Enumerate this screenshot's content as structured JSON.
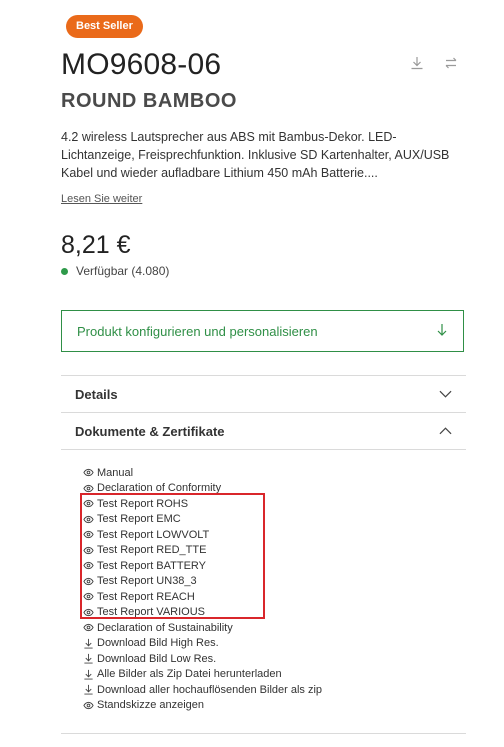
{
  "badge": "Best Seller",
  "product": {
    "code": "MO9608-06",
    "name": "ROUND BAMBOO",
    "description": "4.2 wireless Lautsprecher aus ABS mit Bambus-Dekor. LED-Lichtanzeige, Freisprechfunktion. Inklusive SD Kartenhalter, AUX/USB Kabel und wieder aufladbare Lithium 450 mAh Batterie....",
    "read_more": "Lesen Sie weiter",
    "price": "8,21 €",
    "availability": "Verfügbar (4.080)"
  },
  "configure_label": "Produkt konfigurieren und personalisieren",
  "accordion": {
    "details": "Details",
    "documents": "Dokumente & Zertifikate"
  },
  "documents": [
    {
      "label": "Manual",
      "icon": "eye-icon"
    },
    {
      "label": "Declaration of Conformity",
      "icon": "eye-icon"
    },
    {
      "label": "Test Report ROHS",
      "icon": "eye-icon"
    },
    {
      "label": "Test Report EMC",
      "icon": "eye-icon"
    },
    {
      "label": "Test Report LOWVOLT",
      "icon": "eye-icon"
    },
    {
      "label": "Test Report RED_TTE",
      "icon": "eye-icon"
    },
    {
      "label": "Test Report BATTERY",
      "icon": "eye-icon"
    },
    {
      "label": "Test Report UN38_3",
      "icon": "eye-icon"
    },
    {
      "label": "Test Report REACH",
      "icon": "eye-icon"
    },
    {
      "label": "Test Report VARIOUS",
      "icon": "eye-icon"
    },
    {
      "label": "Declaration of Sustainability",
      "icon": "eye-icon"
    },
    {
      "label": "Download Bild High Res.",
      "icon": "download-icon"
    },
    {
      "label": "Download Bild Low Res.",
      "icon": "download-icon"
    },
    {
      "label": "Alle Bilder als Zip Datei herunterladen",
      "icon": "download-icon"
    },
    {
      "label": "Download aller hochauflösenden Bilder als zip",
      "icon": "download-icon"
    },
    {
      "label": "Standskizze anzeigen",
      "icon": "eye-icon"
    }
  ],
  "colors": {
    "badge": "#ea6a1a",
    "accent_green": "#2f8f46",
    "highlight_red": "#d9262b"
  }
}
